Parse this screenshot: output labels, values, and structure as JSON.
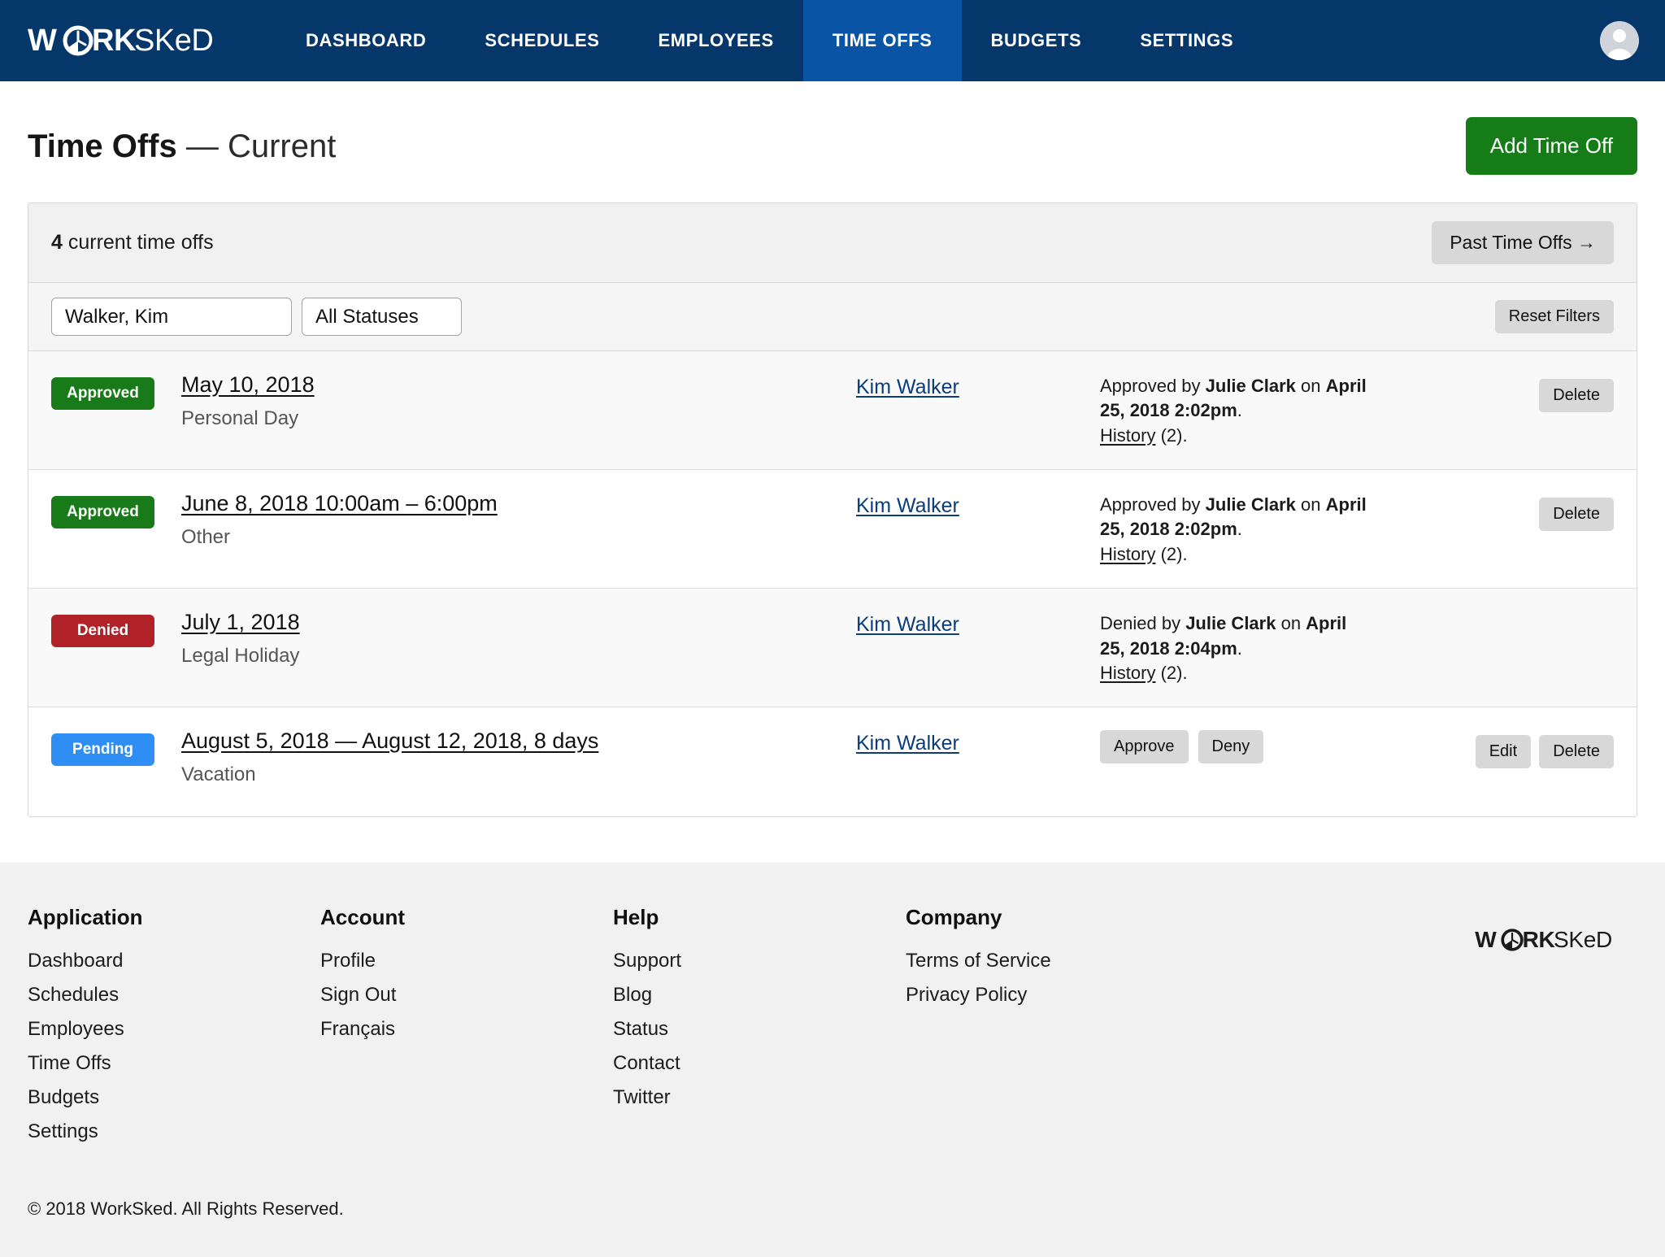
{
  "brand": {
    "logo_text": "WORKSKED",
    "icon": "stopwatch-icon"
  },
  "nav": {
    "items": [
      {
        "label": "DASHBOARD",
        "active": false
      },
      {
        "label": "SCHEDULES",
        "active": false
      },
      {
        "label": "EMPLOYEES",
        "active": false
      },
      {
        "label": "TIME OFFS",
        "active": true
      },
      {
        "label": "BUDGETS",
        "active": false
      },
      {
        "label": "SETTINGS",
        "active": false
      }
    ],
    "avatar": "user-avatar-icon"
  },
  "page": {
    "title_strong": "Time Offs",
    "title_rest": " — Current",
    "add_button": "Add Time Off"
  },
  "card": {
    "count": "4",
    "count_suffix": " current time offs",
    "past_button": "Past Time Offs →",
    "filters": {
      "employee_value": "Walker, Kim",
      "status_value": "All Statuses",
      "reset_label": "Reset Filters"
    }
  },
  "rows": [
    {
      "status": "Approved",
      "status_kind": "approved",
      "title": "May 10, 2018 ",
      "subtitle": "Personal Day",
      "person": "Kim Walker",
      "detail_prefix": "Approved by ",
      "detail_actor": "Julie Clark",
      "detail_mid": " on ",
      "detail_date": "April 25, 2018 2:02pm",
      "detail_suffix": ".",
      "history_label": "History",
      "history_count": " (2).",
      "actions": [
        "Delete"
      ],
      "pending_actions": []
    },
    {
      "status": "Approved",
      "status_kind": "approved",
      "title": "June 8, 2018 10:00am – 6:00pm ",
      "subtitle": "Other",
      "person": "Kim Walker",
      "detail_prefix": "Approved by ",
      "detail_actor": "Julie Clark",
      "detail_mid": " on ",
      "detail_date": "April 25, 2018 2:02pm",
      "detail_suffix": ".",
      "history_label": "History",
      "history_count": " (2).",
      "actions": [
        "Delete"
      ],
      "pending_actions": []
    },
    {
      "status": "Denied",
      "status_kind": "denied",
      "title": "July 1, 2018 ",
      "subtitle": "Legal Holiday",
      "person": "Kim Walker",
      "detail_prefix": "Denied by ",
      "detail_actor": "Julie Clark",
      "detail_mid": " on ",
      "detail_date": "April 25, 2018 2:04pm",
      "detail_suffix": ".",
      "history_label": "History",
      "history_count": " (2).",
      "actions": [],
      "pending_actions": []
    },
    {
      "status": "Pending",
      "status_kind": "pending",
      "title": "August 5, 2018 — August 12, 2018, 8 days ",
      "subtitle": "Vacation",
      "person": "Kim Walker",
      "detail_prefix": "",
      "detail_actor": "",
      "detail_mid": "",
      "detail_date": "",
      "detail_suffix": "",
      "history_label": "",
      "history_count": "",
      "actions": [
        "Edit",
        "Delete"
      ],
      "pending_actions": [
        "Approve",
        "Deny"
      ]
    }
  ],
  "footer": {
    "columns": [
      {
        "heading": "Application",
        "links": [
          "Dashboard",
          "Schedules",
          "Employees",
          "Time Offs",
          "Budgets",
          "Settings"
        ]
      },
      {
        "heading": "Account",
        "links": [
          "Profile",
          "Sign Out",
          "Français"
        ]
      },
      {
        "heading": "Help",
        "links": [
          "Support",
          "Blog",
          "Status",
          "Contact",
          "Twitter"
        ]
      },
      {
        "heading": "Company",
        "links": [
          "Terms of Service",
          "Privacy Policy"
        ]
      }
    ],
    "logo_text": "WORKSKED",
    "copyright": "© 2018 WorkSked. All Rights Reserved."
  },
  "colors": {
    "nav_bg": "#05376b",
    "nav_active": "#0a54a5",
    "primary_green": "#157c18",
    "badge_approved": "#197a19",
    "badge_denied": "#b02128",
    "badge_pending": "#2f8ef4",
    "link_blue": "#0a3d7a"
  }
}
